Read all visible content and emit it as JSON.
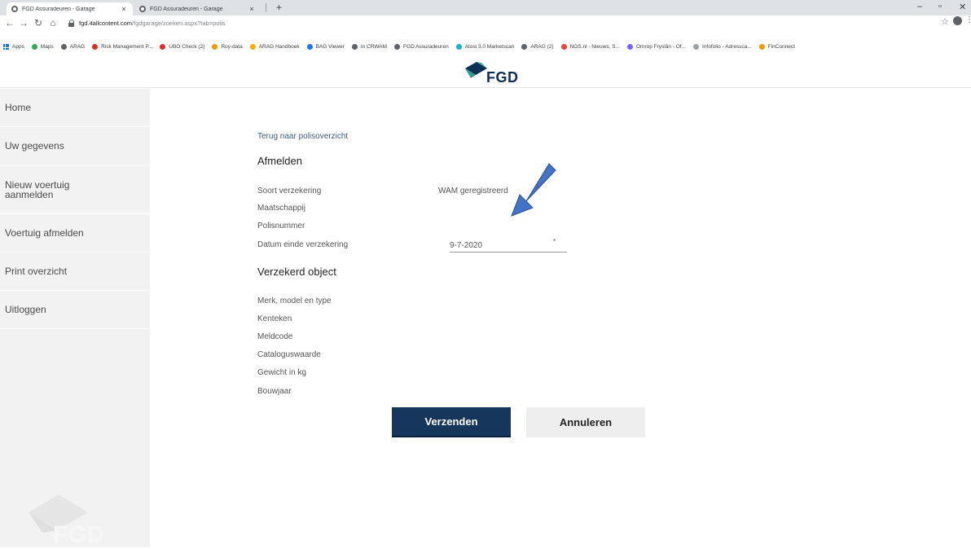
{
  "browser": {
    "tabs": [
      {
        "title": "FGD Assuradeuren - Garage",
        "active": true
      },
      {
        "title": "FGD Assuradeuren - Garage",
        "active": false
      }
    ],
    "url_host": "fgd.4allcontent.com",
    "url_path": "/fgdgarage/zoeken.aspx?tab=polis",
    "bookmarks": [
      {
        "label": "Apps",
        "icon": "apps-grid-icon",
        "color": "#1a73e8"
      },
      {
        "label": "Maps",
        "icon": "maps-pin-icon",
        "color": "#34a853"
      },
      {
        "label": "ARAG",
        "icon": "globe-icon",
        "color": "#5f6368"
      },
      {
        "label": "Risk Management P...",
        "icon": "red-triangle-icon",
        "color": "#d93025"
      },
      {
        "label": "UBO Check (2)",
        "icon": "red-triangle-icon",
        "color": "#d93025"
      },
      {
        "label": "Roy-data",
        "icon": "roy-data-icon",
        "color": "#f29900"
      },
      {
        "label": "ARAG Handboek",
        "icon": "arag-handboek-icon",
        "color": "#f9ab00"
      },
      {
        "label": "BAG Viewer",
        "icon": "bag-viewer-icon",
        "color": "#1a73e8"
      },
      {
        "label": "In CRWAM",
        "icon": "globe-icon",
        "color": "#5f6368"
      },
      {
        "label": "FGD Assuradeuren",
        "icon": "globe-icon",
        "color": "#5f6368"
      },
      {
        "label": "Atosi 3.0 Marketscan",
        "icon": "atosi-icon",
        "color": "#12b5cb"
      },
      {
        "label": "ARAG (2)",
        "icon": "globe-icon",
        "color": "#5f6368"
      },
      {
        "label": "NOS.nl - Nieuws, S...",
        "icon": "nos-icon",
        "color": "#e8453c"
      },
      {
        "label": "Omrop Fryslân - Of...",
        "icon": "omrop-icon",
        "color": "#7b61ff"
      },
      {
        "label": "Infofolio - Adressca...",
        "icon": "infofolio-icon",
        "color": "#9aa0a6"
      },
      {
        "label": "FinConnect",
        "icon": "finconnect-icon",
        "color": "#f29900"
      }
    ]
  },
  "logo": {
    "text": "FGD"
  },
  "sidebar": {
    "items": [
      {
        "label": "Home"
      },
      {
        "label": "Uw gegevens"
      },
      {
        "label": "Nieuw voertuig\naanmelden"
      },
      {
        "label": "Voertuig afmelden"
      },
      {
        "label": "Print overzicht"
      },
      {
        "label": "Uitloggen"
      }
    ],
    "logo_text": "FGD"
  },
  "main": {
    "back_link": "Terug naar polisoverzicht",
    "section_afmelden": "Afmelden",
    "fields_afmelden": [
      {
        "label": "Soort verzekering",
        "value": "WAM geregistreerd"
      },
      {
        "label": "Maatschappij",
        "value": ""
      },
      {
        "label": "Polisnummer",
        "value": ""
      }
    ],
    "end_date": {
      "label": "Datum einde verzekering",
      "value": "9-7-2020",
      "required_mark": "*"
    },
    "section_object": "Verzekerd object",
    "fields_object": [
      {
        "label": "Merk, model en type"
      },
      {
        "label": "Kenteken"
      },
      {
        "label": "Meldcode"
      },
      {
        "label": "Cataloguswaarde"
      },
      {
        "label": "Gewicht in kg"
      },
      {
        "label": "Bouwjaar"
      }
    ],
    "submit_label": "Verzenden",
    "cancel_label": "Annuleren"
  },
  "colors": {
    "primary_button": "#16365b",
    "link": "#3e5d86",
    "sidebar_bg": "#f2f2f2",
    "annotation_arrow": "#4472c4"
  }
}
